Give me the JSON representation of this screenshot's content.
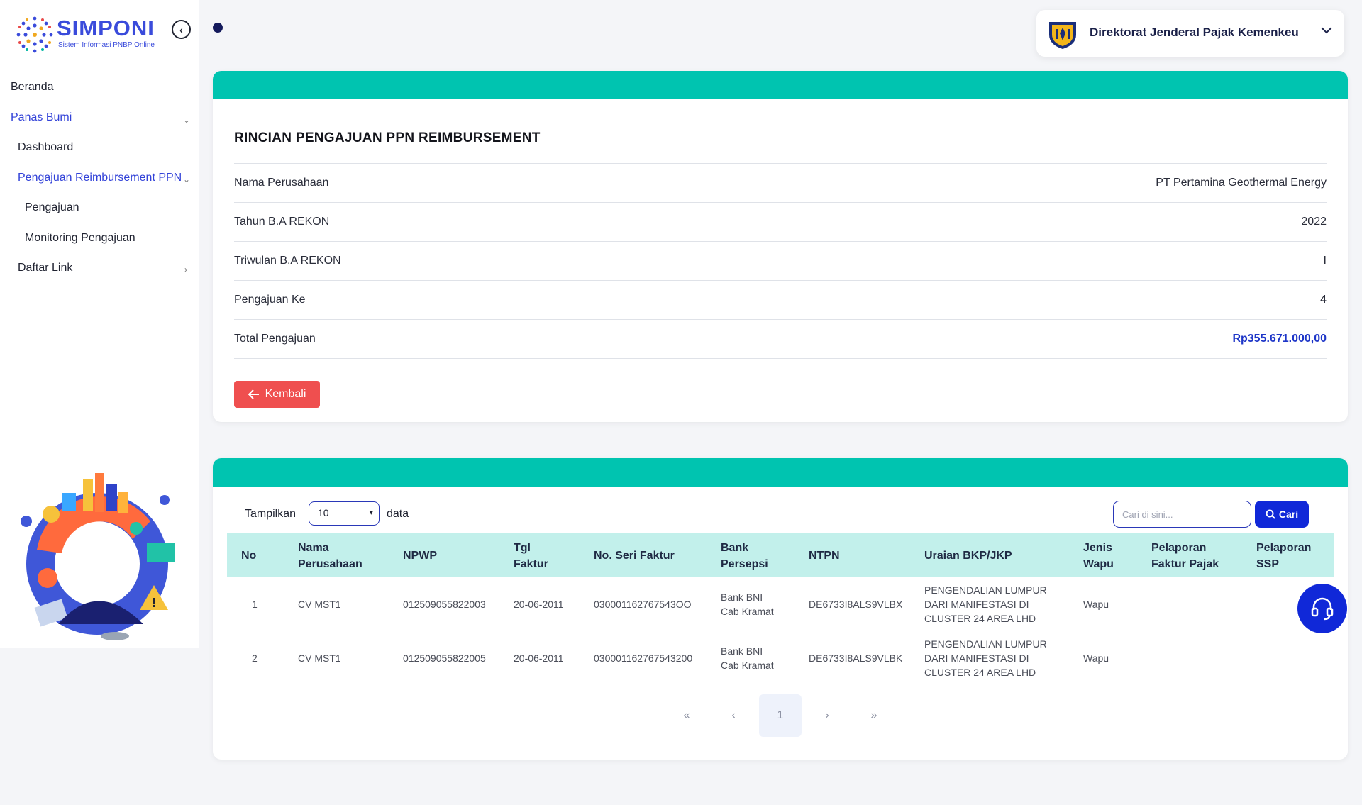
{
  "brand": {
    "title": "SIMPONI",
    "subtitle": "Sistem Informasi PNBP Online"
  },
  "sidebar": {
    "items": [
      {
        "label": "Beranda",
        "active": false
      },
      {
        "label": "Panas Bumi",
        "active": true
      },
      {
        "label": "Dashboard",
        "active": false
      },
      {
        "label": "Pengajuan Reimbursement PPN",
        "active": true
      },
      {
        "label": "Pengajuan",
        "active": false
      },
      {
        "label": "Monitoring Pengajuan",
        "active": false
      },
      {
        "label": "Daftar Link",
        "active": false
      }
    ]
  },
  "header": {
    "org_name": "Direktorat Jenderal Pajak Kemenkeu"
  },
  "detail": {
    "title": "RINCIAN PENGAJUAN PPN REIMBURSEMENT",
    "rows": [
      {
        "label": "Nama Perusahaan",
        "value": "PT Pertamina Geothermal Energy"
      },
      {
        "label": "Tahun B.A REKON",
        "value": "2022"
      },
      {
        "label": "Triwulan B.A REKON",
        "value": "I"
      },
      {
        "label": "Pengajuan Ke",
        "value": "4"
      },
      {
        "label": "Total Pengajuan",
        "value": "Rp355.671.000,00"
      }
    ],
    "back_label": "Kembali"
  },
  "table_controls": {
    "show_label": "Tampilkan",
    "page_size": "10",
    "data_label": "data",
    "search_placeholder": "Cari di sini...",
    "search_button": "Cari"
  },
  "table": {
    "columns": [
      [
        "No"
      ],
      [
        "Nama",
        "Perusahaan"
      ],
      [
        "NPWP"
      ],
      [
        "Tgl",
        "Faktur"
      ],
      [
        "No. Seri Faktur"
      ],
      [
        "Bank",
        "Persepsi"
      ],
      [
        "NTPN"
      ],
      [
        "Uraian BKP/JKP"
      ],
      [
        "Jenis",
        "Wapu"
      ],
      [
        "Pelaporan",
        "Faktur Pajak"
      ],
      [
        "Pelaporan",
        "SSP"
      ]
    ],
    "rows": [
      {
        "no": "1",
        "nama": "CV MST1",
        "npwp": "012509055822003",
        "tgl": "20-06-2011",
        "seri": "030001162767543OO",
        "bank": [
          "Bank BNI",
          "Cab Kramat"
        ],
        "ntpn": "DE6733I8ALS9VLBX",
        "uraian": [
          "PENGENDALIAN LUMPUR",
          "DARI MANIFESTASI DI",
          "CLUSTER 24 AREA LHD"
        ],
        "wapu": "Wapu",
        "pel_faktur": "",
        "pel_ssp": ""
      },
      {
        "no": "2",
        "nama": "CV MST1",
        "npwp": "012509055822005",
        "tgl": "20-06-2011",
        "seri": "030001162767543200",
        "bank": [
          "Bank BNI",
          "Cab Kramat"
        ],
        "ntpn": "DE6733I8ALS9VLBK",
        "uraian": [
          "PENGENDALIAN LUMPUR",
          "DARI MANIFESTASI DI",
          "CLUSTER 24 AREA LHD"
        ],
        "wapu": "Wapu",
        "pel_faktur": "",
        "pel_ssp": ""
      }
    ]
  },
  "pagination": {
    "first": "«",
    "prev": "‹",
    "current": "1",
    "next": "›",
    "last": "»"
  },
  "colors": {
    "accent": "#00c4b0",
    "primary": "#1028d8",
    "danger": "#ef4f4f",
    "table_header": "#c2f0eb"
  },
  "icons": {
    "collapse": "chevron-left-circle-icon",
    "help": "headset-icon",
    "search": "search-icon",
    "back": "arrow-left-icon"
  }
}
